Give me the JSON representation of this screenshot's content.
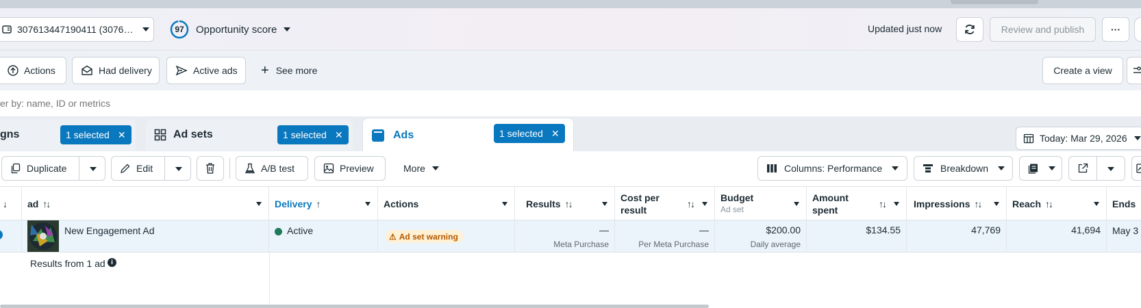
{
  "header": {
    "account_label": "307613447190411 (3076…",
    "opportunity_score_value": "97",
    "opportunity_score_label": "Opportunity score",
    "updated_text": "Updated just now",
    "review_publish_label": "Review and publish",
    "more_label": "···"
  },
  "filters": {
    "actions_label": "Actions",
    "had_delivery_label": "Had delivery",
    "active_ads_label": "Active ads",
    "see_more_label": "See more",
    "create_view_label": "Create a view"
  },
  "search": {
    "placeholder": "er by: name, ID or metrics"
  },
  "tabs": {
    "campaigns": {
      "label": "gns",
      "selected": "1 selected"
    },
    "adsets": {
      "label": "Ad sets",
      "selected": "1 selected"
    },
    "ads": {
      "label": "Ads",
      "selected": "1 selected"
    },
    "date_label": "Today: Mar 29, 2026"
  },
  "toolbar": {
    "duplicate_label": "Duplicate",
    "edit_label": "Edit",
    "ab_test_label": "A/B test",
    "preview_label": "Preview",
    "more_label": "More",
    "columns_label": "Columns: Performance",
    "breakdown_label": "Breakdown"
  },
  "columns": {
    "ad": "ad",
    "delivery": "Delivery",
    "actions": "Actions",
    "results": "Results",
    "cost_line1": "Cost per",
    "cost_line2": "result",
    "budget": "Budget",
    "budget_sub": "Ad set",
    "amount_line1": "Amount",
    "amount_line2": "spent",
    "impressions": "Impressions",
    "reach": "Reach",
    "ends": "Ends"
  },
  "row": {
    "ad_name": "New Engagement Ad",
    "delivery": "Active",
    "warning": "Ad set warning",
    "results": "—",
    "results_sub": "Meta Purchase",
    "cost": "—",
    "cost_sub": "Per Meta Purchase",
    "budget": "$200.00",
    "budget_sub": "Daily average",
    "amount_spent": "$134.55",
    "impressions": "47,769",
    "reach": "41,694",
    "ends": "May 3"
  },
  "summary": {
    "label": "Results from 1 ad"
  },
  "colors": {
    "accent": "#0a78be",
    "active_dot": "#1f7a5c",
    "warning_bg": "#fff1d6",
    "warning_text": "#b35900"
  }
}
